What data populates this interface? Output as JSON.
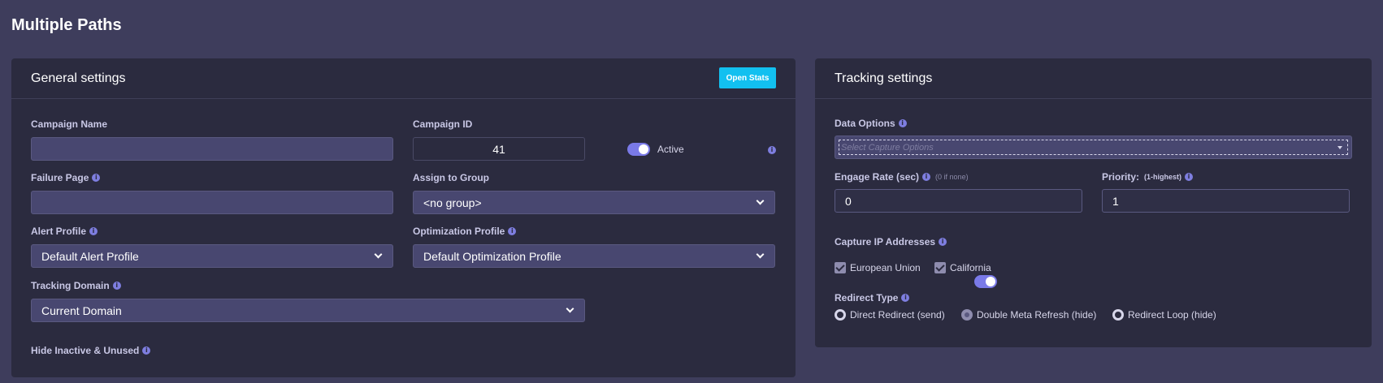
{
  "page": {
    "title": "Multiple Paths"
  },
  "general": {
    "title": "General settings",
    "open_stats": "Open Stats",
    "campaign_name": {
      "label": "Campaign Name",
      "value": ""
    },
    "campaign_id": {
      "label": "Campaign ID",
      "value": "41"
    },
    "active": {
      "label": "Active",
      "on": true
    },
    "failure_page": {
      "label": "Failure Page",
      "value": ""
    },
    "assign_group": {
      "label": "Assign to Group",
      "value": "<no group>"
    },
    "alert_profile": {
      "label": "Alert Profile",
      "value": "Default Alert Profile"
    },
    "optimization_profile": {
      "label": "Optimization Profile",
      "value": "Default Optimization Profile"
    },
    "tracking_domain": {
      "label": "Tracking Domain",
      "value": "Current Domain"
    },
    "hide_inactive": {
      "label": "Hide Inactive & Unused",
      "on": false
    }
  },
  "tracking": {
    "title": "Tracking settings",
    "data_options": {
      "label": "Data Options",
      "placeholder": "Select Capture Options"
    },
    "engage_rate": {
      "label": "Engage Rate (sec)",
      "hint": "(0 if none)",
      "value": "0"
    },
    "priority": {
      "label": "Priority:",
      "hint": "(1-highest)",
      "value": "1"
    },
    "capture_ip": {
      "label": "Capture IP Addresses",
      "on": true
    },
    "regions": [
      {
        "label": "European Union",
        "checked": true
      },
      {
        "label": "California",
        "checked": true
      }
    ],
    "redirect_type": {
      "label": "Redirect Type",
      "options": [
        {
          "label": "Direct Redirect (send)",
          "selected": false
        },
        {
          "label": "Double Meta Refresh (hide)",
          "selected": true
        },
        {
          "label": "Redirect Loop (hide)",
          "selected": false
        }
      ]
    }
  },
  "icons": {
    "info": "info-icon",
    "chevron": "chevron-down-icon"
  },
  "colors": {
    "accent": "#7a7ae8",
    "button": "#12c0f0",
    "background": "#3e3d5c",
    "card": "#2b2b3f"
  }
}
